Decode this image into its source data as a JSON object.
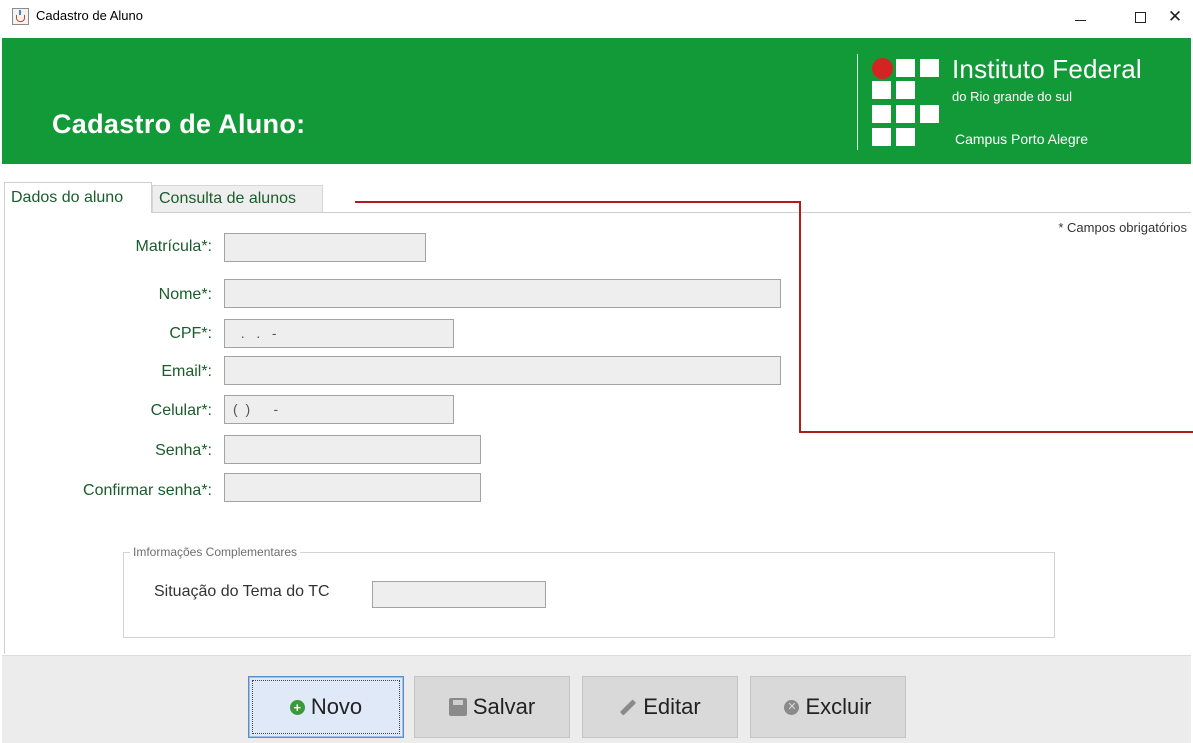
{
  "window": {
    "title": "Cadastro de Aluno",
    "controls": {
      "minimize": "—",
      "maximize": "☐",
      "close": "✕"
    }
  },
  "header": {
    "title": "Cadastro de Aluno:",
    "background_color": "#139a38",
    "logo": {
      "name": "Instituto Federal",
      "subtitle": "do Rio grande do sul",
      "campus": "Campus Porto Alegre",
      "dot_color": "#d42323"
    }
  },
  "tabs": [
    {
      "label": "Dados do aluno",
      "active": true
    },
    {
      "label": "Consulta de alunos",
      "active": false
    }
  ],
  "form": {
    "required_note": "* Campos obrigatórios",
    "fields": [
      {
        "label": "Matrícula*:",
        "value": ""
      },
      {
        "label": "Nome*:",
        "value": ""
      },
      {
        "label": "CPF*:",
        "value": "  .   .   -"
      },
      {
        "label": "Email*:",
        "value": ""
      },
      {
        "label": "Celular*:",
        "value": "(  )      -"
      },
      {
        "label": "Senha*:",
        "value": ""
      },
      {
        "label": "Confirmar senha*:",
        "value": ""
      }
    ],
    "complementary": {
      "legend": "Imformações Complementares",
      "situacao_label": "Situação do Tema do TC",
      "situacao_value": ""
    }
  },
  "buttons": {
    "novo": "Novo",
    "salvar": "Salvar",
    "editar": "Editar",
    "excluir": "Excluir"
  },
  "annotation_color": "#b01c1c"
}
